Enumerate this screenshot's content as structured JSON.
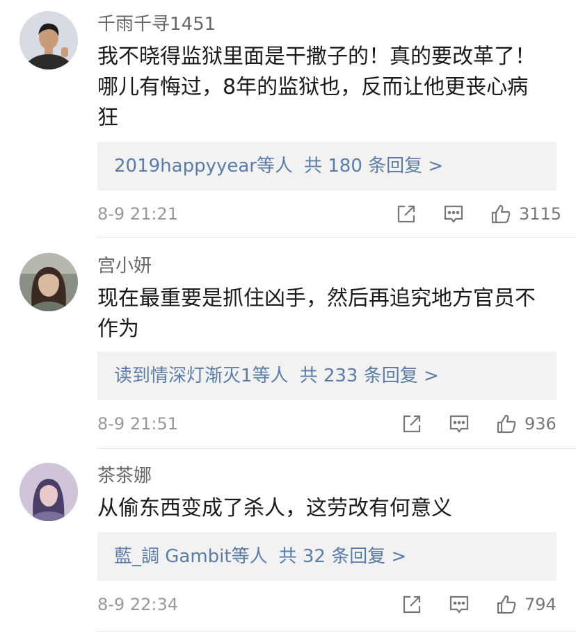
{
  "comments": [
    {
      "username": "千雨千寻1451",
      "lines": [
        "我不晓得监狱里面是干撒子的！真的要改革了！",
        "哪儿有悔过，8年的监狱也，反而让他更丧心病",
        "狂"
      ],
      "reply_users": "2019happyyear",
      "reply_others": "等人",
      "reply_count": "共 180 条回复 >",
      "time": "8-9  21:21",
      "likes": "3115",
      "avatar_colors": {
        "bg": "#d7dbe2",
        "skin": "#c89b7b",
        "hair": "#1c1c1c",
        "cloth": "#2a2a2a"
      }
    },
    {
      "username": "宫小妍",
      "lines": [
        "现在最重要是抓住凶手，然后再追究地方官员不",
        "作为"
      ],
      "reply_users": "读到情深灯渐灭1",
      "reply_others": "等人",
      "reply_count": "共 233 条回复 >",
      "time": "8-9  21:51",
      "likes": "936",
      "avatar_colors": {
        "bg": "#8a8f86",
        "skin": "#d9b9a0",
        "hair": "#3a2a22",
        "cloth": "#6f7468"
      }
    },
    {
      "username": "茶茶娜",
      "lines": [
        "从偷东西变成了杀人，这劳改有何意义"
      ],
      "reply_users": "藍_調 Gambit",
      "reply_others": "等人",
      "reply_count": "共 32 条回复 >",
      "time": "8-9  22:34",
      "likes": "794",
      "avatar_colors": {
        "bg": "#cfc4d8",
        "skin": "#e8c9c9",
        "hair": "#4a3f66",
        "cloth": "#7a6f9a"
      }
    }
  ],
  "icons": {
    "share": "share-icon",
    "reply": "comment-icon",
    "like": "thumbs-up-icon"
  },
  "colors": {
    "link": "#5a7ca7",
    "muted": "#999999",
    "reply_bg": "#f2f2f2"
  }
}
